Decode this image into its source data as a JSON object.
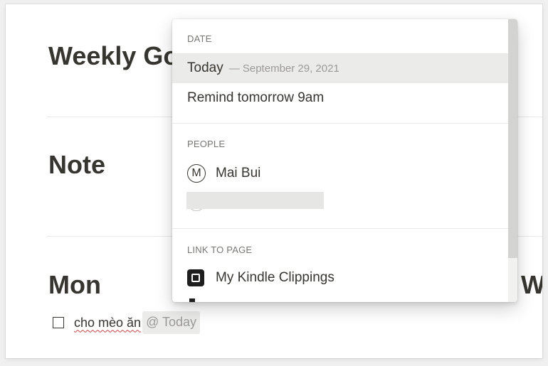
{
  "document": {
    "headings": [
      "Weekly Go",
      "Note",
      "Mon",
      "W"
    ],
    "todo": {
      "text": "cho mèo ăn",
      "mention": "@ Today"
    }
  },
  "menu": {
    "date_section": {
      "label": "DATE",
      "items": [
        {
          "label": "Today",
          "sub": "— September 29, 2021"
        },
        {
          "label": "Remind tomorrow 9am"
        }
      ]
    },
    "people_section": {
      "label": "PEOPLE",
      "items": [
        {
          "initial": "M",
          "name": "Mai Bui"
        }
      ]
    },
    "link_section": {
      "label": "LINK TO PAGE",
      "items": [
        {
          "label": "My Kindle Clippings",
          "icon": "kindle-icon"
        }
      ]
    }
  }
}
